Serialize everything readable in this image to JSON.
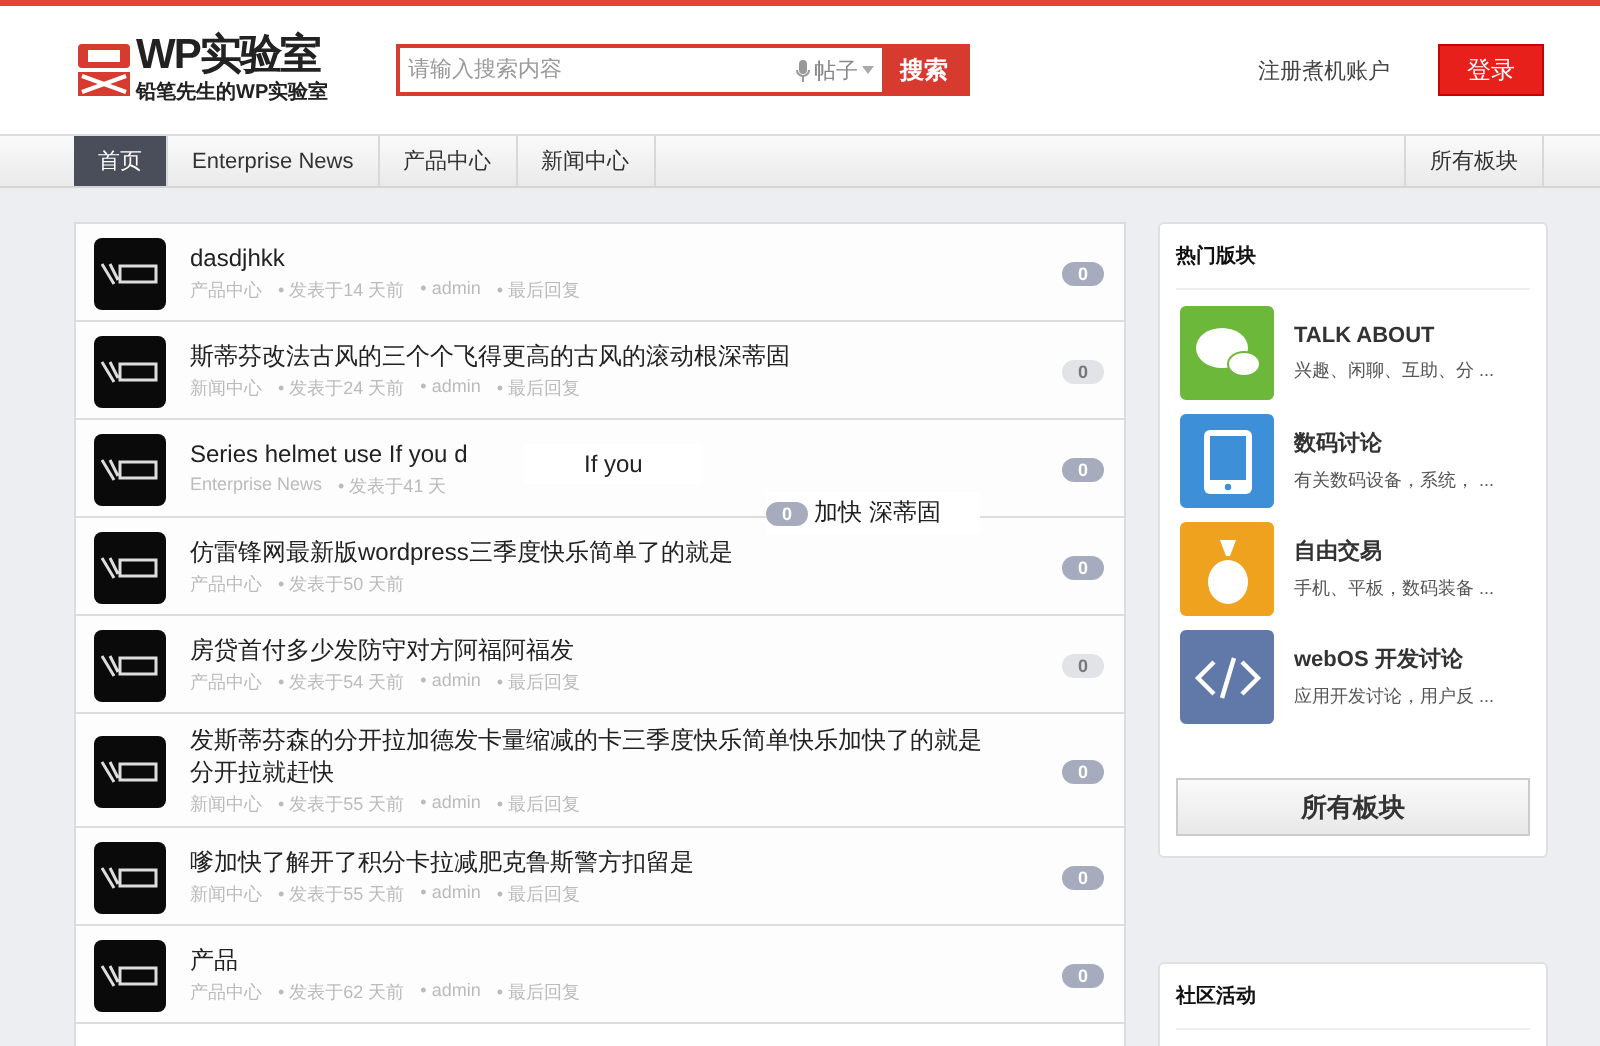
{
  "header": {
    "logo_title": "WP实验室",
    "logo_subtitle": "铅笔先生的WP实验室",
    "search": {
      "placeholder": "请输入搜索内容",
      "scope": "帖子",
      "button": "搜索"
    },
    "register_link": "注册煮机账户",
    "login_button": "登录"
  },
  "nav": {
    "items": [
      {
        "label": "首页",
        "selected": true
      },
      {
        "label": "Enterprise News",
        "selected": false
      },
      {
        "label": "产品中心",
        "selected": false
      },
      {
        "label": "新闻中心",
        "selected": false
      }
    ],
    "right": "所有板块"
  },
  "posts": [
    {
      "title": "dasdjhkk",
      "category": "产品中心",
      "time": "• 发表于14 天前",
      "author": "• admin",
      "last": "• 最后回复",
      "count": "0",
      "faded": false
    },
    {
      "title": "斯蒂芬改法古风的三个个飞得更高的古风的滚动根深蒂固",
      "category": "新闻中心",
      "time": "• 发表于24 天前",
      "author": "• admin",
      "last": "• 最后回复",
      "count": "0",
      "faded": true
    },
    {
      "title": "Series helmet use If you d",
      "category": "Enterprise News",
      "time": "• 发表于41 天",
      "count": "0",
      "faded": false
    },
    {
      "title": "仿雷锋网最新版wordpress三季度快乐简单了的就是",
      "category": "产品中心",
      "time": "• 发表于50 天前",
      "count": "0",
      "faded": false
    },
    {
      "title": "房贷首付多少发防守对方阿福阿福发",
      "category": "产品中心",
      "time": "• 发表于54 天前",
      "author": "• admin",
      "last": "• 最后回复",
      "count": "0",
      "faded": true
    },
    {
      "title": "发斯蒂芬森的分开拉加德发卡量缩减的卡三季度快乐简单快乐加快了的就是分开拉就赶快",
      "category": "新闻中心",
      "time": "• 发表于55 天前",
      "author": "• admin",
      "last": "• 最后回复",
      "count": "0",
      "faded": false
    },
    {
      "title": "嗲加快了解开了积分卡拉减肥克鲁斯警方扣留是",
      "category": "新闻中心",
      "time": "• 发表于55 天前",
      "author": "• admin",
      "last": "• 最后回复",
      "count": "0",
      "faded": false
    },
    {
      "title": "产品",
      "category": "产品中心",
      "time": "• 发表于62 天前",
      "author": "• admin",
      "last": "• 最后回复",
      "count": "0",
      "faded": false
    }
  ],
  "overlay": {
    "text_1": "If you",
    "count": "0",
    "text_2": "加快 深蒂固"
  },
  "sidebar": {
    "hot_title": "热门版块",
    "boards": [
      {
        "kind": "chat",
        "name": "TALK ABOUT",
        "desc": "兴趣、闲聊、互助、分 ..."
      },
      {
        "kind": "tablet",
        "name": "数码讨论",
        "desc": "有关数码设备，系统， ..."
      },
      {
        "kind": "money",
        "name": "自由交易",
        "desc": "手机、平板，数码装备 ..."
      },
      {
        "kind": "code",
        "name": "webOS 开发讨论",
        "desc": "应用开发讨论，用户反 ..."
      }
    ],
    "all_button": "所有板块",
    "community_title": "社区活动"
  }
}
